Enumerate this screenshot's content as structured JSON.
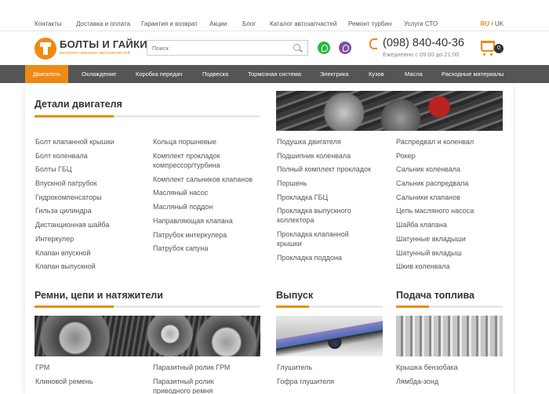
{
  "top_links": [
    "Контакты",
    "Доставка и оплата",
    "Гарантия и возврат",
    "Акции",
    "Блог",
    "Каталог автозапчастей",
    "Ремонт турбин",
    "Услуги СТО"
  ],
  "lang": {
    "ru": "RU",
    "sep": "/",
    "uk": "UK"
  },
  "logo": {
    "name": "БОЛТЫ И ГАЙКИ",
    "tagline": "интернет-магазин автозапчастей"
  },
  "search": {
    "placeholder": "Поиск"
  },
  "contact": {
    "phone": "(098) 840-40-36",
    "hours": "Ежедневно с 09:00 до 21:00"
  },
  "cart": {
    "count": "0"
  },
  "nav": [
    "Двигатель",
    "Охлаждение",
    "Коробка передач",
    "Подвеска",
    "Тормозная система",
    "Электрика",
    "Кузов",
    "Масла",
    "Расходные материалы"
  ],
  "sections": {
    "engine": {
      "title": "Детали двигателя",
      "col1": [
        "Болт клапанной крышки",
        "Болт коленвала",
        "Болты ГБЦ",
        "Впускной патрубок",
        "Гидрокомпенсаторы",
        "Гильза цилиндра",
        "Дистанционная шайба",
        "Интеркулер",
        "Клапан впускной",
        "Клапан выпускной"
      ],
      "col2": [
        "Кольца поршневые",
        "Комплект прокладок",
        "компрессор/турбина",
        "Комплект сальников клапанов",
        "Масляный насос",
        "Масляный поддон",
        "Направляющая клапана",
        "Патрубок интеркулера",
        "Патрубок сапуна"
      ],
      "col3": [
        "Подушка двигателя",
        "Подшипник коленвала",
        "Полный комплект прокладок",
        "Поршень",
        "Прокладка ГБЦ",
        "Прокладка выпускного",
        "коллектора",
        "Прокладка клапанной",
        "крышки",
        "Прокладка поддона"
      ],
      "col4": [
        "Распредвал и коленвал",
        "Рокер",
        "Сальник коленвала",
        "Сальник распредвала",
        "Сальники клапанов",
        "Цепь масляного насоса",
        "Шайба клапана",
        "Шатунные вкладыши",
        "Шатунный вкладыш",
        "Шкив коленвала"
      ]
    },
    "belts": {
      "title": "Ремни, цепи и натяжители",
      "col1": [
        "ГРМ",
        "Клиновой ремень"
      ],
      "col2": [
        "Паразитный ролик ГРМ",
        "Паразитный ролик",
        "приводного ремня"
      ]
    },
    "exhaust": {
      "title": "Выпуск",
      "items": [
        "Глушитель",
        "Гофра глушителя"
      ]
    },
    "fuel": {
      "title": "Подача топлива",
      "items": [
        "Крышка бензобака",
        "Лямбда-зонд"
      ]
    }
  }
}
